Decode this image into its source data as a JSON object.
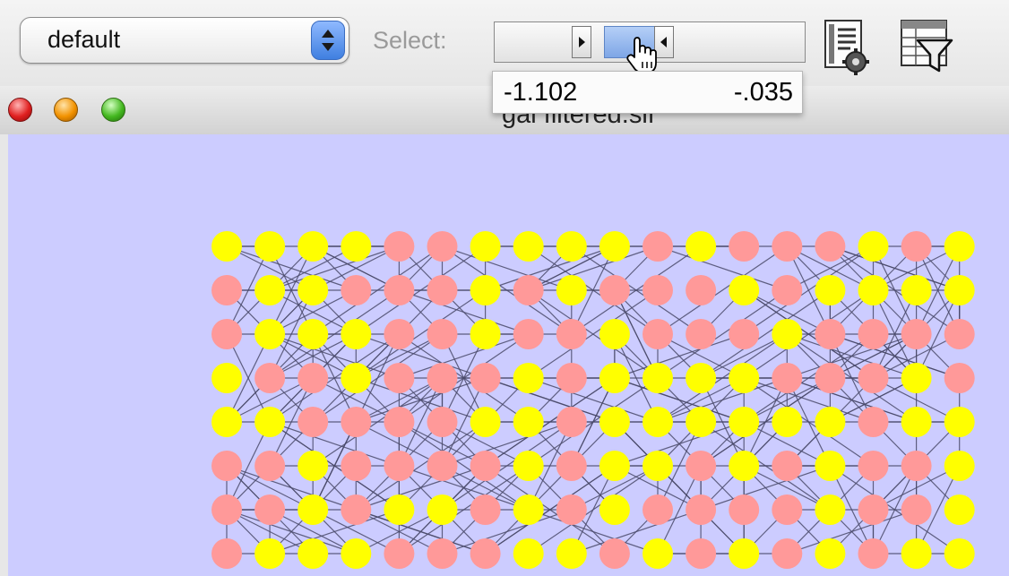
{
  "toolbar": {
    "visual_style": "default",
    "select_label": "Select:",
    "range": {
      "min": "-1.102",
      "max": "-.035"
    }
  },
  "window": {
    "title": "gal filtered.sif"
  },
  "colors": {
    "canvas_bg": "#ccccff",
    "node_yellow": "#ffff00",
    "node_pink": "#ff9999",
    "edge": "#4a4a6a"
  },
  "network": {
    "node_rows": [
      "YYYYPPYYYYPYPPPYPY",
      "PYYPPPYPYPPPYPYYYY",
      "PYYYPPYPPYPPPYPPPP",
      "YPPYPPPYPYYYYPPPYP",
      "YYPPPPYYPYYYYYYPYY",
      "PPYPPPPYPYYPYPYPPY",
      "PPYPYYPYPYPPPPYPPY",
      "PYYYPPPYYPYPYPYPYY"
    ]
  }
}
